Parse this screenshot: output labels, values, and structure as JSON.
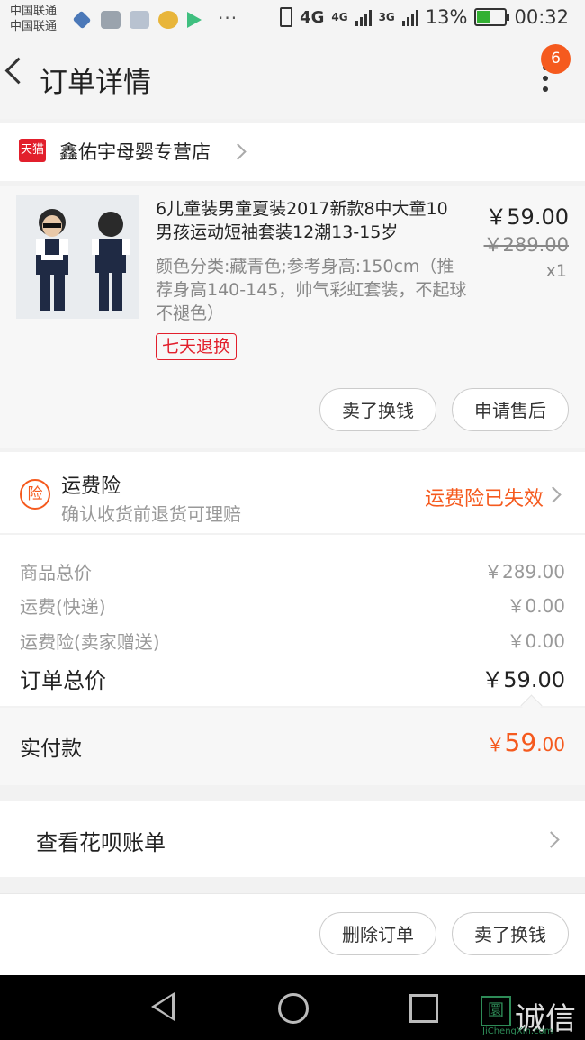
{
  "status_bar": {
    "carrier_1": "中国联通",
    "carrier_2": "中国联通",
    "more": "···",
    "network_1": "4G",
    "network_2": "4G",
    "network_3": "3G",
    "battery": "13%",
    "time": "00:32"
  },
  "header": {
    "title": "订单详情",
    "badge_count": "6"
  },
  "shop": {
    "brand_tag": "天猫",
    "name": "鑫佑宇母婴专营店"
  },
  "product": {
    "title": "6儿童装男童夏装2017新款8中大童10男孩运动短袖套装12潮13-15岁",
    "spec": "颜色分类:藏青色;参考身高:150cm（推荐身高140-145，帅气彩虹套装，不起球不褪色）",
    "price": "￥59.00",
    "original_price": "￥289.00",
    "quantity": "x1",
    "return_tag": "七天退换",
    "btn_sell": "卖了换钱",
    "btn_after_sale": "申请售后"
  },
  "insurance": {
    "icon_text": "险",
    "title": "运费险",
    "subtitle": "确认收货前退货可理赔",
    "status": "运费险已失效"
  },
  "summary": {
    "items": [
      {
        "label": "商品总价",
        "value": "￥289.00"
      },
      {
        "label": "运费(快递)",
        "value": "￥0.00"
      },
      {
        "label": "运费险(卖家赠送)",
        "value": "￥0.00"
      }
    ],
    "total_label": "订单总价",
    "total_value": "￥59.00",
    "paid_label": "实付款",
    "paid_symbol": "￥",
    "paid_int": "59",
    "paid_dec": ".00"
  },
  "huabei": {
    "label": "查看花呗账单"
  },
  "bottom_bar": {
    "btn_delete": "删除订单",
    "btn_sell": "卖了换钱"
  },
  "watermark": {
    "box": "圜",
    "text": "诚信",
    "sub": "JiChengXin.com"
  },
  "colors": {
    "accent": "#f55a1e",
    "tmall_red": "#e21f2c"
  }
}
